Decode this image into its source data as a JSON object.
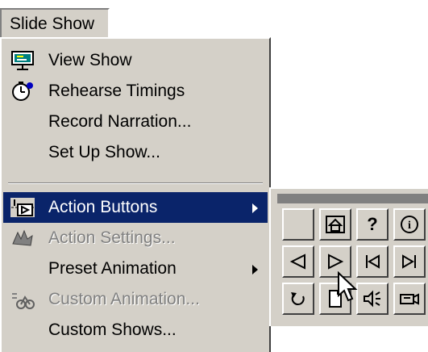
{
  "menu": {
    "title": "Slide Show",
    "items": [
      {
        "label": "View Show",
        "icon": "view-show-icon",
        "enabled": true
      },
      {
        "label": "Rehearse Timings",
        "icon": "rehearse-timings-icon",
        "enabled": true
      },
      {
        "label": "Record Narration...",
        "enabled": true
      },
      {
        "label": "Set Up Show...",
        "enabled": true
      },
      {
        "label": "Action Buttons",
        "icon": "action-buttons-icon",
        "enabled": true,
        "selected": true,
        "has_submenu": true
      },
      {
        "label": "Action Settings...",
        "icon": "action-settings-icon",
        "enabled": false
      },
      {
        "label": "Preset Animation",
        "enabled": true,
        "has_submenu": true
      },
      {
        "label": "Custom Animation...",
        "icon": "custom-animation-icon",
        "enabled": false
      },
      {
        "label": "Custom Shows...",
        "enabled": true
      }
    ]
  },
  "submenu": {
    "buttons": [
      {
        "name": "custom-action-button",
        "icon": "blank-icon"
      },
      {
        "name": "home-action-button",
        "icon": "home-icon"
      },
      {
        "name": "help-action-button",
        "icon": "question-mark-icon",
        "glyph": "?"
      },
      {
        "name": "information-action-button",
        "icon": "information-icon",
        "glyph": "i"
      },
      {
        "name": "back-action-button",
        "icon": "back-arrow-icon"
      },
      {
        "name": "forward-action-button",
        "icon": "forward-arrow-icon"
      },
      {
        "name": "beginning-action-button",
        "icon": "beginning-icon"
      },
      {
        "name": "end-action-button",
        "icon": "end-icon"
      },
      {
        "name": "return-action-button",
        "icon": "return-icon"
      },
      {
        "name": "document-action-button",
        "icon": "document-icon"
      },
      {
        "name": "sound-action-button",
        "icon": "sound-icon"
      },
      {
        "name": "movie-action-button",
        "icon": "movie-icon"
      }
    ]
  },
  "colors": {
    "menu_bg": "#d4d0c8",
    "highlight_bg": "#0a246a",
    "disabled_text": "#808080"
  }
}
